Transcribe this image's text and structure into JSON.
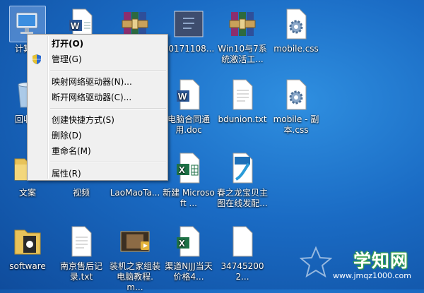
{
  "desktop": {
    "icons": [
      {
        "label": "计算机"
      },
      {
        "label": ""
      },
      {
        "label": ""
      },
      {
        "label": "20171108..."
      },
      {
        "label": "Win10与7系统激活工..."
      },
      {
        "label": "mobile.css"
      },
      {
        "label": "回收站"
      },
      {
        "label": "电脑合同通用.doc"
      },
      {
        "label": "bdunion.txt"
      },
      {
        "label": "mobile - 副本.css"
      },
      {
        "label": "文案"
      },
      {
        "label": "视频"
      },
      {
        "label": "LaoMaoTa..."
      },
      {
        "label": "新建 Microsoft ..."
      },
      {
        "label": "春之龙宝贝主图在线发配..."
      },
      {
        "label": "software"
      },
      {
        "label": "南京售后记录.txt"
      },
      {
        "label": "装机之家组装电脑教程.m..."
      },
      {
        "label": "渠道NJJJ当天价格4..."
      },
      {
        "label": "347452002..."
      }
    ]
  },
  "context_menu": {
    "items": {
      "open": "打开(O)",
      "manage": "管理(G)",
      "map_drive": "映射网络驱动器(N)...",
      "disconnect_drive": "断开网络驱动器(C)...",
      "create_shortcut": "创建快捷方式(S)",
      "delete": "删除(D)",
      "rename": "重命名(M)",
      "properties": "属性(R)"
    }
  },
  "watermark": {
    "title": "学知网",
    "url": "www.jmqz1000.com"
  },
  "colors": {
    "desktop_bg": "#1a6bc4",
    "menu_bg": "#f0f0f0",
    "watermark_green": "#3aa34a"
  }
}
